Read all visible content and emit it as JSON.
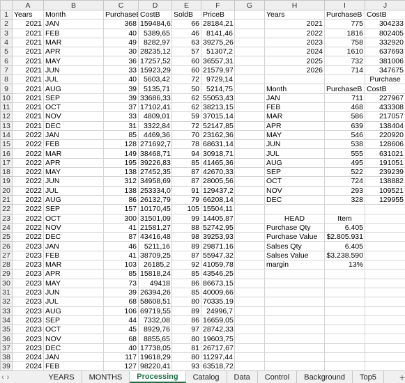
{
  "columns": [
    "A",
    "B",
    "C",
    "D",
    "E",
    "F",
    "G",
    "H",
    "I",
    "J"
  ],
  "row_numbers": [
    "1",
    "2",
    "3",
    "4",
    "5",
    "6",
    "7",
    "8",
    "9",
    "10",
    "11",
    "12",
    "13",
    "14",
    "15",
    "16",
    "17",
    "18",
    "19",
    "20",
    "21",
    "22",
    "23",
    "24",
    "25",
    "26",
    "27",
    "28",
    "29",
    "30",
    "31",
    "32",
    "33",
    "34",
    "35",
    "36",
    "37",
    "38",
    "39"
  ],
  "rows": [
    [
      "Years",
      "Month",
      "PurchaseB",
      "CostB",
      "SoldB",
      "PriceB",
      "",
      "Years",
      "PurchaseB",
      "CostB"
    ],
    [
      "2021",
      "JAN",
      "368",
      "159484,62",
      "66",
      "28184,21",
      "",
      "2021",
      "775",
      "304233"
    ],
    [
      "2021",
      "FEB",
      "40",
      "5389,65",
      "46",
      "8141,46",
      "",
      "2022",
      "1816",
      "802405"
    ],
    [
      "2021",
      "MAR",
      "49",
      "8282,97",
      "63",
      "39275,26",
      "",
      "2023",
      "758",
      "332920"
    ],
    [
      "2021",
      "APR",
      "30",
      "28235,12",
      "57",
      "51307,2",
      "",
      "2024",
      "1610",
      "637693"
    ],
    [
      "2021",
      "MAY",
      "36",
      "17257,52",
      "60",
      "36557,31",
      "",
      "2025",
      "732",
      "381006"
    ],
    [
      "2021",
      "JUN",
      "33",
      "15923,29",
      "60",
      "21579,97",
      "",
      "2026",
      "714",
      "347675"
    ],
    [
      "2021",
      "JUL",
      "40",
      "5603,42",
      "72",
      "9729,14",
      "",
      "",
      "",
      "Purchase"
    ],
    [
      "2021",
      "AUG",
      "39",
      "5135,71",
      "50",
      "5214,75",
      "",
      "Month",
      "PurchaseB",
      "CostB"
    ],
    [
      "2021",
      "SEP",
      "39",
      "33686,33",
      "62",
      "55053,43",
      "",
      "JAN",
      "711",
      "227967"
    ],
    [
      "2021",
      "OCT",
      "37",
      "17102,41",
      "62",
      "38213,15",
      "",
      "FEB",
      "468",
      "433308"
    ],
    [
      "2021",
      "NOV",
      "33",
      "4809,01",
      "59",
      "37015,14",
      "",
      "MAR",
      "586",
      "217057"
    ],
    [
      "2021",
      "DEC",
      "31",
      "3322,84",
      "72",
      "52147,85",
      "",
      "APR",
      "639",
      "138404"
    ],
    [
      "2022",
      "JAN",
      "85",
      "4469,36",
      "70",
      "23162,36",
      "",
      "MAY",
      "546",
      "220920"
    ],
    [
      "2022",
      "FEB",
      "128",
      "271692,71",
      "78",
      "68631,14",
      "",
      "JUN",
      "538",
      "128606"
    ],
    [
      "2022",
      "MAR",
      "149",
      "38468,71",
      "94",
      "30918,71",
      "",
      "JUL",
      "555",
      "631021"
    ],
    [
      "2022",
      "APR",
      "195",
      "39226,83",
      "85",
      "41465,36",
      "",
      "AUG",
      "495",
      "191051"
    ],
    [
      "2022",
      "MAY",
      "138",
      "27452,35",
      "87",
      "42670,33",
      "",
      "SEP",
      "522",
      "239239"
    ],
    [
      "2022",
      "JUN",
      "312",
      "34958,69",
      "87",
      "28005,56",
      "",
      "OCT",
      "724",
      "138882"
    ],
    [
      "2022",
      "JUL",
      "138",
      "253334,07",
      "91",
      "129437,2",
      "",
      "NOV",
      "293",
      "109521"
    ],
    [
      "2022",
      "AUG",
      "86",
      "26132,79",
      "79",
      "66208,14",
      "",
      "DEC",
      "328",
      "129955"
    ],
    [
      "2022",
      "SEP",
      "157",
      "10170,45",
      "105",
      "15504,11",
      "",
      "",
      "",
      ""
    ],
    [
      "2022",
      "OCT",
      "300",
      "31501,09",
      "99",
      "14405,87",
      "",
      "HEAD",
      "Item",
      ""
    ],
    [
      "2022",
      "NOV",
      "41",
      "21581,27",
      "88",
      "52742,95",
      "",
      "Purchase Qty",
      "6.405",
      ""
    ],
    [
      "2022",
      "DEC",
      "87",
      "43416,48",
      "98",
      "39253,93",
      "",
      "Purchase Value",
      "$2.805.931",
      ""
    ],
    [
      "2023",
      "JAN",
      "46",
      "5211,16",
      "89",
      "29871,16",
      "",
      "Salses Qty",
      "6.405",
      ""
    ],
    [
      "2023",
      "FEB",
      "41",
      "38709,25",
      "87",
      "55947,32",
      "",
      "Salses Value",
      "$3.238.590",
      ""
    ],
    [
      "2023",
      "MAR",
      "103",
      "26185,2",
      "92",
      "41059,78",
      "",
      "margin",
      "13%",
      ""
    ],
    [
      "2023",
      "APR",
      "85",
      "15818,24",
      "85",
      "43546,25",
      "",
      "",
      "",
      ""
    ],
    [
      "2023",
      "MAY",
      "73",
      "49418",
      "86",
      "86673,15",
      "",
      "",
      "",
      ""
    ],
    [
      "2023",
      "JUN",
      "39",
      "26394,26",
      "85",
      "40009,66",
      "",
      "",
      "",
      ""
    ],
    [
      "2023",
      "JUL",
      "68",
      "58608,51",
      "80",
      "70335,19",
      "",
      "",
      "",
      ""
    ],
    [
      "2023",
      "AUG",
      "106",
      "69719,55",
      "89",
      "24996,7",
      "",
      "",
      "",
      ""
    ],
    [
      "2023",
      "SEP",
      "44",
      "7332,08",
      "86",
      "16659,05",
      "",
      "",
      "",
      ""
    ],
    [
      "2023",
      "OCT",
      "45",
      "8929,76",
      "97",
      "28742,33",
      "",
      "",
      "",
      ""
    ],
    [
      "2023",
      "NOV",
      "68",
      "8855,65",
      "80",
      "19603,75",
      "",
      "",
      "",
      ""
    ],
    [
      "2023",
      "DEC",
      "40",
      "17738,05",
      "81",
      "26717,67",
      "",
      "",
      "",
      ""
    ],
    [
      "2024",
      "JAN",
      "117",
      "19618,29",
      "80",
      "11297,44",
      "",
      "",
      "",
      ""
    ],
    [
      "2024",
      "FEB",
      "127",
      "98220,41",
      "93",
      "63518,72",
      "",
      "",
      "",
      ""
    ]
  ],
  "sheet_tabs": [
    "YEARS",
    "MONTHS",
    "Processing",
    "Catalog",
    "Data",
    "Control",
    "Background",
    "Top5"
  ],
  "active_tab": "Processing",
  "nav": {
    "prev_icon": "‹",
    "next_icon": "›",
    "add_icon": "+"
  },
  "accent_color": "#1e7145"
}
